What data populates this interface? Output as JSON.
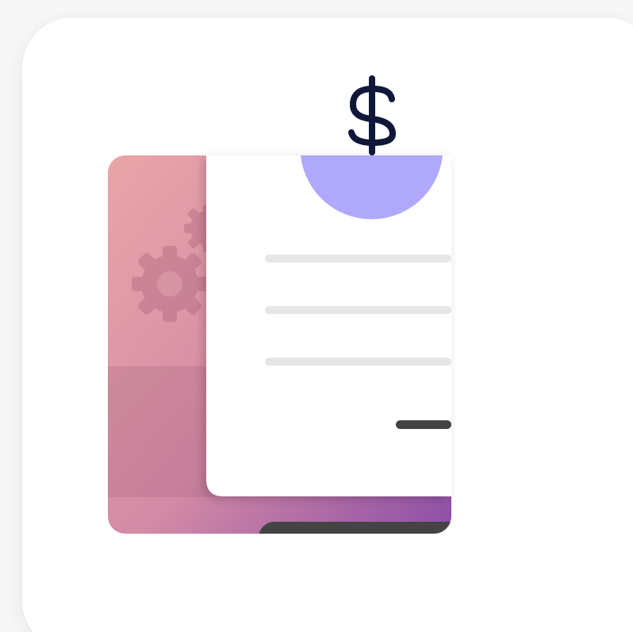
{
  "icon": {
    "name": "invoice-payment-icon",
    "symbol_label": "$",
    "colors": {
      "tile_background": "#ffffff",
      "panel_gradient_start": "#e8a6a8",
      "panel_gradient_mid": "#d38aa5",
      "panel_gradient_end": "#8c4ea8",
      "panel_lower_band": "#b57a8e",
      "gear": "#bf7f92",
      "document": "#ffffff",
      "document_line": "#e6e6e6",
      "total_bar": "#444444",
      "coin_half": "#b0a9fb",
      "dollar_stroke": "#0f1838",
      "tray_bar": "#444444"
    },
    "document_lines_count": 3,
    "gears_count": 2
  }
}
